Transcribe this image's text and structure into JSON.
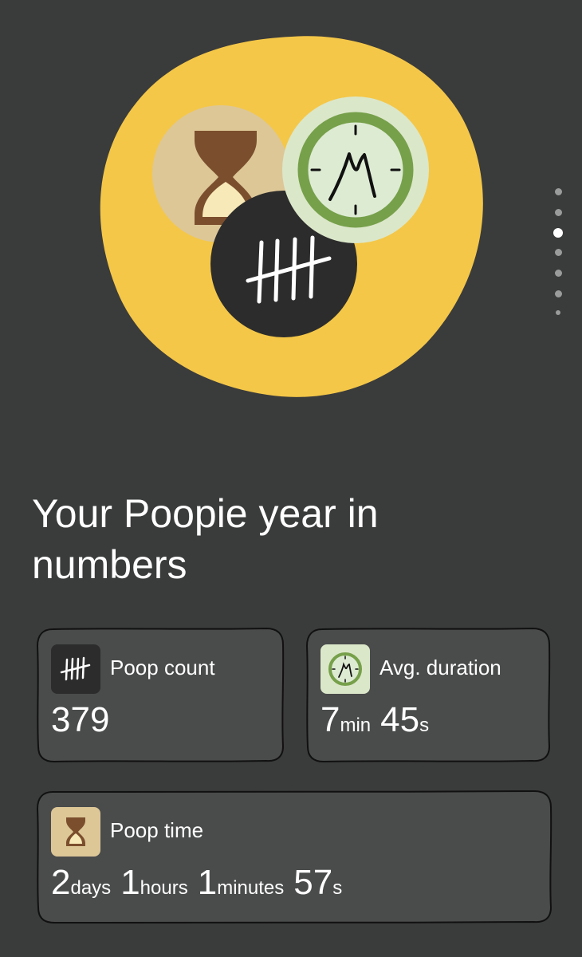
{
  "hero": {
    "illustration_icons": [
      "hourglass-icon",
      "clock-icon",
      "tally-marks-icon"
    ],
    "colors": {
      "blob": "#f4c748",
      "hourglass_circle": "#ddc797",
      "hourglass": "#7b4f2d",
      "sand": "#f7e9b8",
      "clock_outer": "#dbe7c9",
      "clock_ring": "#76a04a",
      "tally_circle": "#2c2c2c"
    }
  },
  "pager": {
    "count": 7,
    "active_index": 2
  },
  "title": "Your Poopie year in numbers",
  "cards": {
    "poop_count": {
      "label": "Poop count",
      "icon": "tally-marks-icon",
      "value": "379"
    },
    "avg_duration": {
      "label": "Avg. duration",
      "icon": "clock-icon",
      "minutes": "7",
      "minutes_unit": "min",
      "seconds": "45",
      "seconds_unit": "s"
    },
    "poop_time": {
      "label": "Poop time",
      "icon": "hourglass-icon",
      "days": "2",
      "days_unit": "days",
      "hours": "1",
      "hours_unit": "hours",
      "minutes": "1",
      "minutes_unit": "minutes",
      "seconds": "57",
      "seconds_unit": "s"
    }
  },
  "colors": {
    "background": "#3a3b3b",
    "card_fill": "#4a4b4b",
    "card_border": "#111111",
    "text": "#ffffff"
  }
}
